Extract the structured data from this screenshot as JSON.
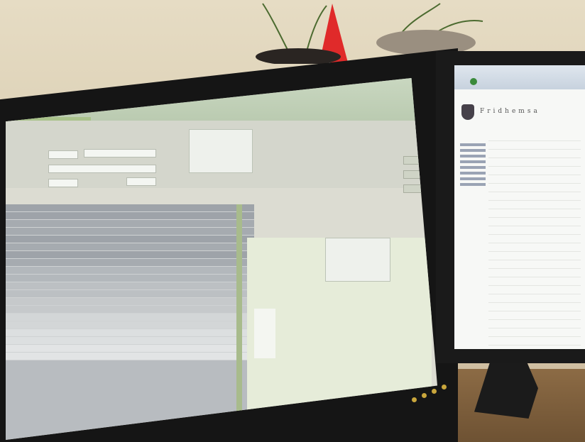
{
  "scene": "photo",
  "left_app": {
    "top_left_status": "",
    "side_buttons": [
      "",
      "",
      "",
      "",
      "",
      ""
    ],
    "memo_top": "",
    "memo_bottom": ""
  },
  "right_browser": {
    "site_title": "Fridhemsa"
  }
}
